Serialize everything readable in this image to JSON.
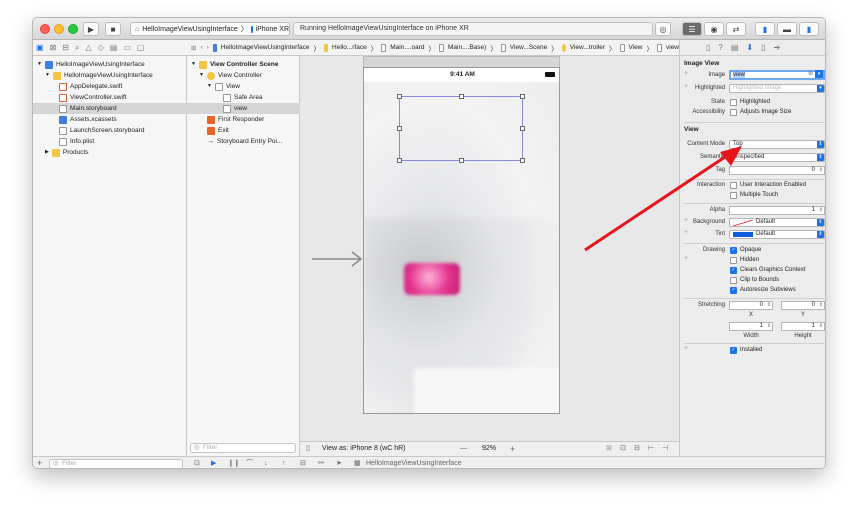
{
  "titlebar": {
    "scheme_target": "HelloImageViewUsingInterface",
    "scheme_device": "iPhone XR",
    "activity_status": "Running HelloImageViewUsingInterface on iPhone XR"
  },
  "navigator": {
    "items": [
      {
        "label": "HelloImageViewUsingInterface",
        "kind": "project",
        "indent": 0,
        "selected": false
      },
      {
        "label": "HelloImageViewUsingInterface",
        "kind": "folder",
        "indent": 1,
        "selected": false
      },
      {
        "label": "AppDelegate.swift",
        "kind": "swift",
        "indent": 2,
        "selected": false
      },
      {
        "label": "ViewController.swift",
        "kind": "swift",
        "indent": 2,
        "selected": false
      },
      {
        "label": "Main.storyboard",
        "kind": "storyboard",
        "indent": 2,
        "selected": true
      },
      {
        "label": "Assets.xcassets",
        "kind": "assets",
        "indent": 2,
        "selected": false
      },
      {
        "label": "LaunchScreen.storyboard",
        "kind": "storyboard",
        "indent": 2,
        "selected": false
      },
      {
        "label": "Info.plist",
        "kind": "plist",
        "indent": 2,
        "selected": false
      },
      {
        "label": "Products",
        "kind": "folder",
        "indent": 1,
        "selected": false
      }
    ],
    "filter_placeholder": "Filter"
  },
  "jumpbar": {
    "crumbs": [
      "HelloImageViewUsingInterface",
      "Hello...rface",
      "Main....oard",
      "Main....Base)",
      "View...Scene",
      "View...troller",
      "View",
      "view"
    ]
  },
  "outline": {
    "items": [
      {
        "label": "View Controller Scene",
        "bold": true,
        "indent": 0,
        "selected": false
      },
      {
        "label": "View Controller",
        "bold": false,
        "indent": 1,
        "selected": false
      },
      {
        "label": "View",
        "bold": false,
        "indent": 2,
        "selected": false
      },
      {
        "label": "Safe Area",
        "bold": false,
        "indent": 3,
        "selected": false
      },
      {
        "label": "view",
        "bold": false,
        "indent": 3,
        "selected": true
      },
      {
        "label": "First Responder",
        "bold": false,
        "indent": 1,
        "selected": false
      },
      {
        "label": "Exit",
        "bold": false,
        "indent": 1,
        "selected": false
      },
      {
        "label": "Storyboard Entry Poi...",
        "bold": false,
        "indent": 1,
        "selected": false
      }
    ],
    "filter_placeholder": "Filter"
  },
  "canvas": {
    "status_time": "9:41 AM",
    "view_as": "View as: iPhone 8 (wC hR)",
    "zoom": "92%",
    "zoom_minus": "—",
    "zoom_plus": "+"
  },
  "debug_bar": {
    "target": "HelloImageViewUsingInterface"
  },
  "inspector": {
    "image_view": {
      "title": "Image View",
      "image_label": "Image",
      "image_value": "view",
      "highlighted_label": "Highlighted",
      "highlighted_placeholder": "Highlighted Image",
      "state_label": "State",
      "state_option": "Highlighted",
      "accessibility_label": "Accessibility",
      "accessibility_option": "Adjusts Image Size"
    },
    "view": {
      "title": "View",
      "content_mode_label": "Content Mode",
      "content_mode_value": "Top",
      "semantic_label": "Semantic",
      "semantic_value": "Unspecified",
      "tag_label": "Tag",
      "tag_value": "0",
      "interaction_label": "Interaction",
      "interaction_options": [
        "User Interaction Enabled",
        "Multiple Touch"
      ],
      "alpha_label": "Alpha",
      "alpha_value": "1",
      "background_label": "Background",
      "background_value": "Default",
      "tint_label": "Tint",
      "tint_value": "Default",
      "drawing_label": "Drawing",
      "drawing_options": [
        {
          "label": "Opaque",
          "checked": true
        },
        {
          "label": "Hidden",
          "checked": false
        },
        {
          "label": "Clears Graphics Context",
          "checked": true
        },
        {
          "label": "Clip to Bounds",
          "checked": false
        },
        {
          "label": "Autoresize Subviews",
          "checked": true
        }
      ],
      "stretching_label": "Stretching",
      "stretch_x": "0",
      "stretch_y": "0",
      "x_label": "X",
      "y_label": "Y",
      "stretch_w": "1",
      "stretch_h": "1",
      "width_label": "Width",
      "height_label": "Height",
      "installed_label": "Installed"
    }
  },
  "colors": {
    "accent": "#1a73e8",
    "annotation_arrow": "#e8141c",
    "tint_swatch": "#0a5ed8"
  }
}
